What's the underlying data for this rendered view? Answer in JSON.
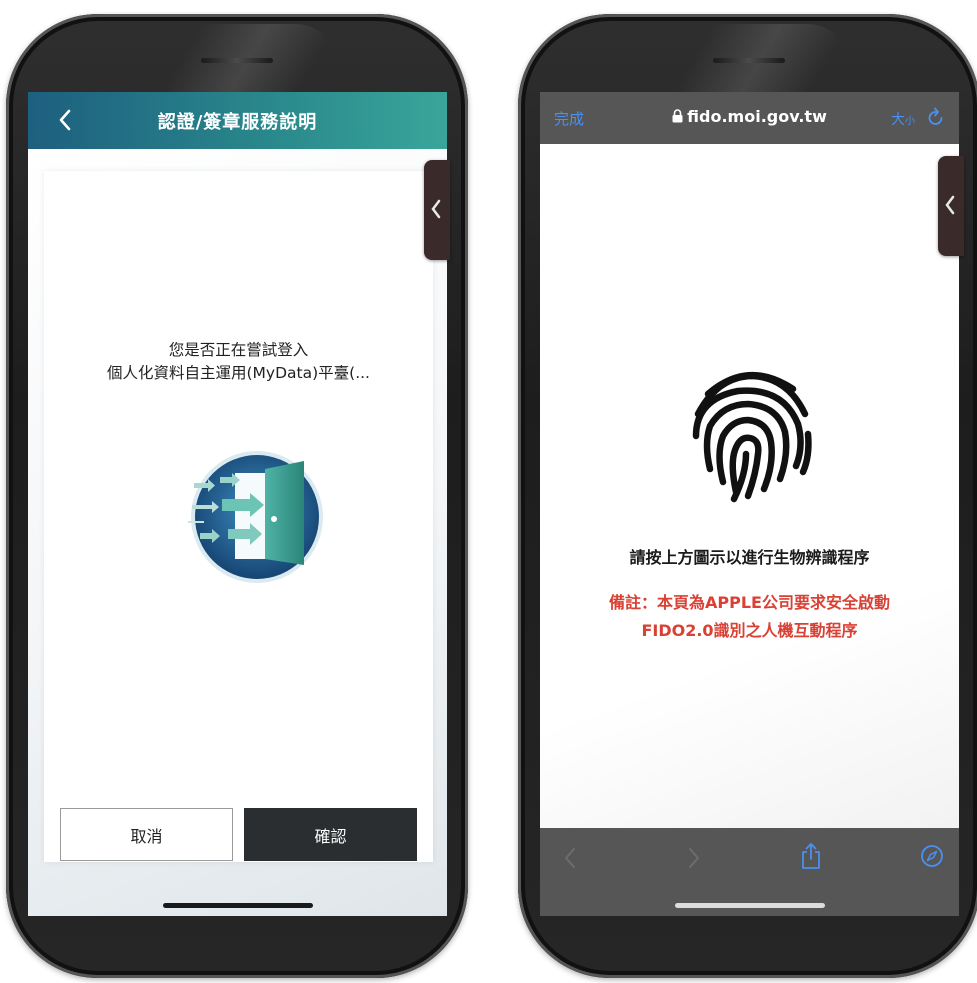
{
  "left_phone": {
    "header": {
      "back_icon": "chevron-left-icon",
      "title": "認證/簽章服務說明"
    },
    "prompt": {
      "line1": "您是否正在嘗試登入",
      "line2": "個人化資料自主運用(MyData)平臺(..."
    },
    "graphic": "door-login-illustration",
    "buttons": {
      "cancel": "取消",
      "confirm": "確認"
    },
    "side_tab_icon": "chevron-left-icon"
  },
  "right_phone": {
    "toolbar": {
      "done": "完成",
      "url": "fido.moi.gov.tw",
      "text_size_big": "大",
      "text_size_small": "小",
      "reload_icon": "reload-icon"
    },
    "content": {
      "icon": "fingerprint-icon",
      "instruction": "請按上方圖示以進行生物辨識程序",
      "note_line1": "備註：本頁為APPLE公司要求安全啟動",
      "note_line2": "FIDO2.0識別之人機互動程序"
    },
    "bottom_bar": {
      "icons": [
        "back-icon",
        "forward-icon",
        "share-icon",
        "compass-icon"
      ]
    },
    "side_tab_icon": "chevron-left-icon"
  },
  "colors": {
    "header_gradient_start": "#1d5f7f",
    "header_gradient_end": "#3aa59a",
    "confirm_button": "#2b2e31",
    "safari_bar": "#565656",
    "safari_accent": "#4a90f0",
    "note_red": "#d94135"
  }
}
